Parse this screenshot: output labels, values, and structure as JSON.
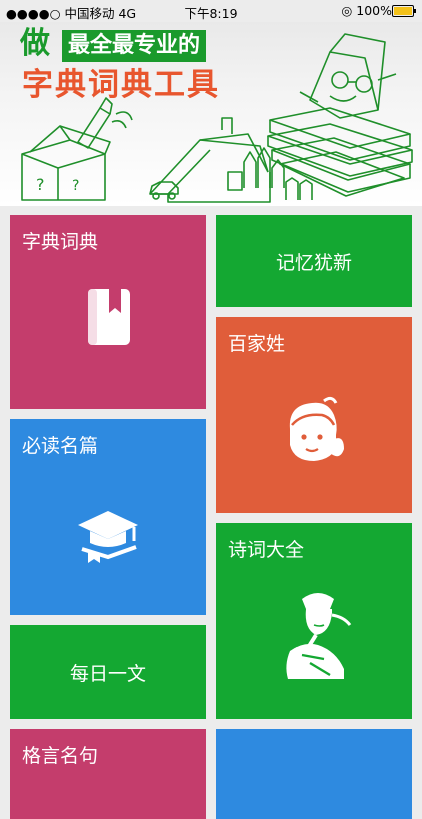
{
  "status_bar": {
    "carrier": "●●●●○ 中国移动  4G",
    "time": "下午8:19",
    "battery": "◎ 100%"
  },
  "banner": {
    "lead_char": "做",
    "slogan_line1": "最全最专业的",
    "slogan_line2": "字典词典工具"
  },
  "tiles": {
    "dictionary": {
      "label": "字典词典",
      "color": "#c43d6c",
      "icon": "book-bookmark-icon"
    },
    "memory": {
      "label": "记忆犹新",
      "color": "#14a832"
    },
    "surnames": {
      "label": "百家姓",
      "color": "#e05d3a",
      "icon": "child-face-icon"
    },
    "must_read": {
      "label": "必读名篇",
      "color": "#2e8ae0",
      "icon": "graduation-cap-book-icon"
    },
    "poetry": {
      "label": "诗词大全",
      "color": "#14a832",
      "icon": "ancient-poet-icon"
    },
    "daily_article": {
      "label": "每日一文",
      "color": "#14a832"
    },
    "quotes": {
      "label": "格言名句",
      "color": "#c43d6c"
    }
  }
}
